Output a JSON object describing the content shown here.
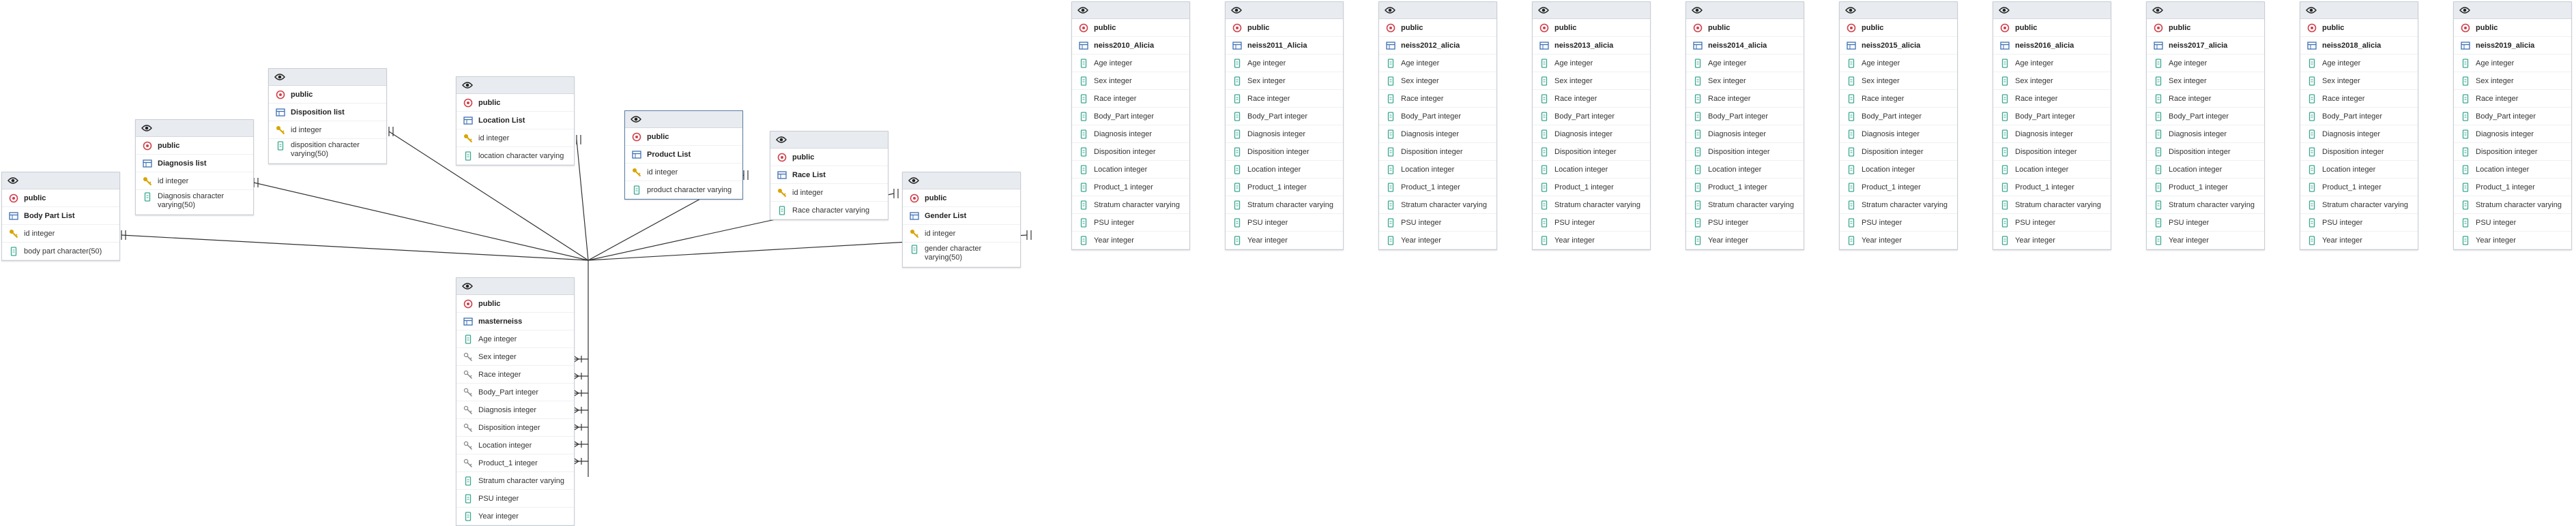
{
  "icons": {
    "visibility": "eye-icon",
    "schema": "schema-icon",
    "table": "table-icon",
    "key": "key-icon",
    "foreign_key": "foreign-key-icon",
    "column": "column-icon"
  },
  "colors": {
    "schema_icon": "#d0404a",
    "table_icon": "#3c6fb4",
    "key_icon": "#d9a400",
    "column_icon": "#3aa890",
    "header_bg": "#e8ebef",
    "line": "#333333"
  },
  "tables": [
    {
      "id": "body_part_list",
      "schema": "public",
      "name": "Body Part List",
      "columns": [
        {
          "kind": "key",
          "text": "id integer"
        },
        {
          "kind": "column",
          "text": "body part character(50)"
        }
      ]
    },
    {
      "id": "diagnosis_list",
      "schema": "public",
      "name": "Diagnosis list",
      "columns": [
        {
          "kind": "key",
          "text": "id integer"
        },
        {
          "kind": "column",
          "text": "Diagnosis character varying(50)"
        }
      ]
    },
    {
      "id": "disposition_list",
      "schema": "public",
      "name": "Disposition list",
      "columns": [
        {
          "kind": "key",
          "text": "id integer"
        },
        {
          "kind": "column",
          "text": "disposition character varying(50)"
        }
      ]
    },
    {
      "id": "location_list",
      "schema": "public",
      "name": "Location List",
      "columns": [
        {
          "kind": "key",
          "text": "id integer"
        },
        {
          "kind": "column",
          "text": "location character varying"
        }
      ]
    },
    {
      "id": "product_list",
      "schema": "public",
      "name": "Product List",
      "columns": [
        {
          "kind": "key",
          "text": "id integer"
        },
        {
          "kind": "column",
          "text": "product character varying"
        }
      ]
    },
    {
      "id": "race_list",
      "schema": "public",
      "name": "Race List",
      "columns": [
        {
          "kind": "key",
          "text": "id integer"
        },
        {
          "kind": "column",
          "text": "Race character varying"
        }
      ]
    },
    {
      "id": "gender_list",
      "schema": "public",
      "name": "Gender List",
      "columns": [
        {
          "kind": "key",
          "text": "id integer"
        },
        {
          "kind": "column",
          "text": "gender character varying(50)"
        }
      ]
    },
    {
      "id": "masterneiss",
      "schema": "public",
      "name": "masterneiss",
      "columns": [
        {
          "kind": "column",
          "text": "Age integer"
        },
        {
          "kind": "foreign_key",
          "text": "Sex integer"
        },
        {
          "kind": "foreign_key",
          "text": "Race integer"
        },
        {
          "kind": "foreign_key",
          "text": "Body_Part integer"
        },
        {
          "kind": "foreign_key",
          "text": "Diagnosis integer"
        },
        {
          "kind": "foreign_key",
          "text": "Disposition integer"
        },
        {
          "kind": "foreign_key",
          "text": "Location integer"
        },
        {
          "kind": "foreign_key",
          "text": "Product_1 integer"
        },
        {
          "kind": "column",
          "text": "Stratum character varying"
        },
        {
          "kind": "column",
          "text": "PSU integer"
        },
        {
          "kind": "column",
          "text": "Year integer"
        }
      ]
    },
    {
      "id": "neiss2010",
      "schema": "public",
      "name": "neiss2010_Alicia",
      "columns": "neiss_columns"
    },
    {
      "id": "neiss2011",
      "schema": "public",
      "name": "neiss2011_Alicia",
      "columns": "neiss_columns"
    },
    {
      "id": "neiss2012",
      "schema": "public",
      "name": "neiss2012_alicia",
      "columns": "neiss_columns"
    },
    {
      "id": "neiss2013",
      "schema": "public",
      "name": "neiss2013_alicia",
      "columns": "neiss_columns"
    },
    {
      "id": "neiss2014",
      "schema": "public",
      "name": "neiss2014_alicia",
      "columns": "neiss_columns"
    },
    {
      "id": "neiss2015",
      "schema": "public",
      "name": "neiss2015_alicia",
      "columns": "neiss_columns"
    },
    {
      "id": "neiss2016",
      "schema": "public",
      "name": "neiss2016_alicia",
      "columns": "neiss_columns"
    },
    {
      "id": "neiss2017",
      "schema": "public",
      "name": "neiss2017_alicia",
      "columns": "neiss_columns"
    },
    {
      "id": "neiss2018",
      "schema": "public",
      "name": "neiss2018_alicia",
      "columns": "neiss_columns"
    },
    {
      "id": "neiss2019",
      "schema": "public",
      "name": "neiss2019_alicia",
      "columns": "neiss_columns"
    }
  ],
  "neiss_columns": [
    {
      "kind": "column",
      "text": "Age integer"
    },
    {
      "kind": "column",
      "text": "Sex integer"
    },
    {
      "kind": "column",
      "text": "Race integer"
    },
    {
      "kind": "column",
      "text": "Body_Part integer"
    },
    {
      "kind": "column",
      "text": "Diagnosis integer"
    },
    {
      "kind": "column",
      "text": "Disposition integer"
    },
    {
      "kind": "column",
      "text": "Location integer"
    },
    {
      "kind": "column",
      "text": "Product_1 integer"
    },
    {
      "kind": "column",
      "text": "Stratum character varying"
    },
    {
      "kind": "column",
      "text": "PSU integer"
    },
    {
      "kind": "column",
      "text": "Year integer"
    }
  ]
}
